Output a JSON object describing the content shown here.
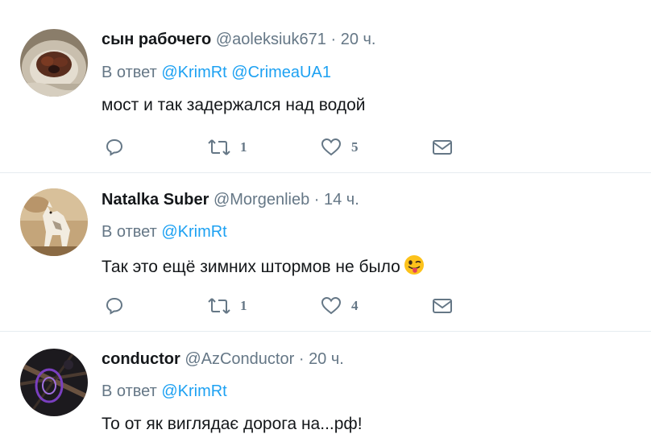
{
  "tweets": [
    {
      "name": "сын рабочего",
      "handle": "@aoleksiuk671",
      "separator": "·",
      "time": "20 ч.",
      "reply_prefix": "В ответ",
      "mentions": [
        "@KrimRt",
        "@CrimeaUA1"
      ],
      "text": "мост и так задержался над водой",
      "retweets": "1",
      "likes": "5",
      "avatar_icon": "dog-avatar"
    },
    {
      "name": "Natalka Suber",
      "handle": "@Morgenlieb",
      "separator": "·",
      "time": "14 ч.",
      "reply_prefix": "В ответ",
      "mentions": [
        "@KrimRt"
      ],
      "text": "Так это ещё зимних штормов не было",
      "emoji": "winking-tongue-emoji",
      "retweets": "1",
      "likes": "4",
      "avatar_icon": "wolf-painting-avatar"
    },
    {
      "name": "conductor",
      "handle": "@AzConductor",
      "separator": "·",
      "time": "20 ч.",
      "reply_prefix": "В ответ",
      "mentions": [
        "@KrimRt"
      ],
      "text": "То от як виглядає дорога на...рф!",
      "avatar_icon": "dark-abstract-avatar"
    }
  ],
  "icons": {
    "reply": "reply-icon",
    "retweet": "retweet-icon",
    "like": "heart-icon",
    "dm": "envelope-icon"
  },
  "colors": {
    "name": "#14171a",
    "secondary": "#657786",
    "mention": "#1da1f2",
    "divider": "#e6ecf0"
  }
}
